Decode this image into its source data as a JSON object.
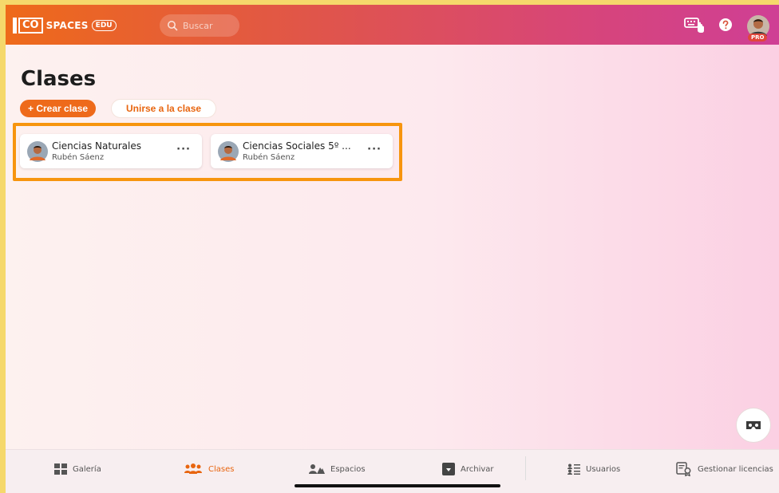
{
  "header": {
    "logo": {
      "co": "CO",
      "spaces": "SPACES",
      "edu": "EDU"
    },
    "search": {
      "placeholder": "Buscar"
    },
    "icons": [
      "keyboard-touch-icon",
      "help-icon"
    ],
    "avatar_badge": "PRO"
  },
  "page": {
    "title": "Clases",
    "create_label": "+ Crear clase",
    "join_label": "Unirse a la clase"
  },
  "classes": [
    {
      "name": "Ciencias Naturales",
      "owner": "Rubén Sáenz",
      "more": "···"
    },
    {
      "name": "Ciencias Sociales 5º ...",
      "owner": "Rubén Sáenz",
      "more": "···"
    }
  ],
  "nav": {
    "items": [
      {
        "label": "Galería",
        "icon": "gallery-icon",
        "active": false
      },
      {
        "label": "Clases",
        "icon": "classes-icon",
        "active": true
      },
      {
        "label": "Espacios",
        "icon": "spaces-icon",
        "active": false
      },
      {
        "label": "Archivar",
        "icon": "archive-icon",
        "active": false
      },
      {
        "label": "Usuarios",
        "icon": "users-icon",
        "active": false
      },
      {
        "label": "Gestionar licencias",
        "icon": "licenses-icon",
        "active": false
      }
    ]
  },
  "colors": {
    "accent": "#ee6a1a",
    "highlight": "#f7950e",
    "header_end": "#cf3f95"
  }
}
